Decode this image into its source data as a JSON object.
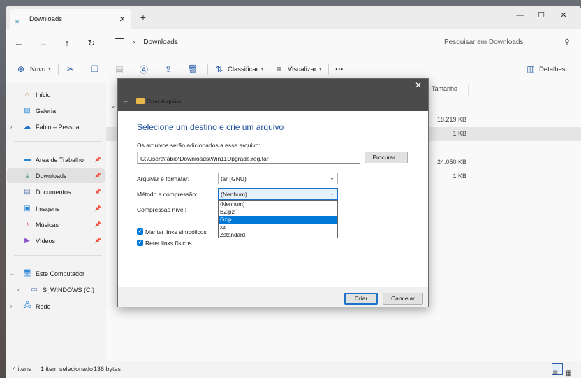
{
  "tab": {
    "title": "Downloads",
    "close_glyph": "✕",
    "new_glyph": "+"
  },
  "window_controls": {
    "minimize": "—",
    "maximize": "☐",
    "close": "✕"
  },
  "address": {
    "path": "Downloads",
    "separator": "›",
    "search_placeholder": "Pesquisar em Downloads"
  },
  "nav": {
    "back": "←",
    "forward": "→",
    "up": "↑",
    "refresh": "↻"
  },
  "command_bar": {
    "new_label": "Novo",
    "sort_label": "Classificar",
    "view_label": "Visualizar",
    "more_label": "···",
    "details_label": "Detalhes"
  },
  "sidebar": {
    "items": [
      {
        "label": "Início",
        "icon": "home-icon"
      },
      {
        "label": "Galeria",
        "icon": "gallery-icon"
      },
      {
        "label": "Fabio – Pessoal",
        "icon": "cloud-icon"
      },
      {
        "label": "Área de Trabalho",
        "icon": "desktop-icon"
      },
      {
        "label": "Downloads",
        "icon": "download-icon"
      },
      {
        "label": "Documentos",
        "icon": "documents-icon"
      },
      {
        "label": "Imagens",
        "icon": "images-icon"
      },
      {
        "label": "Músicas",
        "icon": "music-icon"
      },
      {
        "label": "Vídeos",
        "icon": "videos-icon"
      },
      {
        "label": "Este Computador",
        "icon": "computer-icon"
      },
      {
        "label": "S_WINDOWS (C:)",
        "icon": "drive-icon"
      },
      {
        "label": "Rede",
        "icon": "network-icon"
      }
    ]
  },
  "content": {
    "size_header": "Tamanho",
    "sizes": [
      "18.219 KB",
      "1 KB",
      "24.050 KB",
      "1 KB"
    ]
  },
  "status": {
    "item_count": "4 itens",
    "selection": "1 item selecionado",
    "selection_size": "136 bytes"
  },
  "dialog": {
    "title": "Criar Arquivo",
    "close_glyph": "✕",
    "heading": "Selecione um destino e crie um arquivo",
    "files_label": "Os arquivos serão adicionados a esse arquivo:",
    "path_value": "C:\\Users\\fabio\\Downloads\\Win11Upgrade.reg.tar",
    "browse_label": "Procurar...",
    "format_label": "Arquivar e formatar:",
    "format_value": "tar (GNU)",
    "method_label": "Método e compressão:",
    "method_value": "(Nenhum)",
    "level_label": "Compressão nível:",
    "method_options": [
      "(Nenhum)",
      "BZip2",
      "Gzip",
      "xz",
      "Zstandard"
    ],
    "highlighted_option": "Gzip",
    "symlinks_label": "Manter links simbólicos",
    "hardlinks_label": "Reter links físicos",
    "create_label": "Criar",
    "cancel_label": "Cancelar"
  },
  "colors": {
    "accent": "#0078d7",
    "heading": "#1f4e9a",
    "titlebar": "#4b4b4b"
  }
}
